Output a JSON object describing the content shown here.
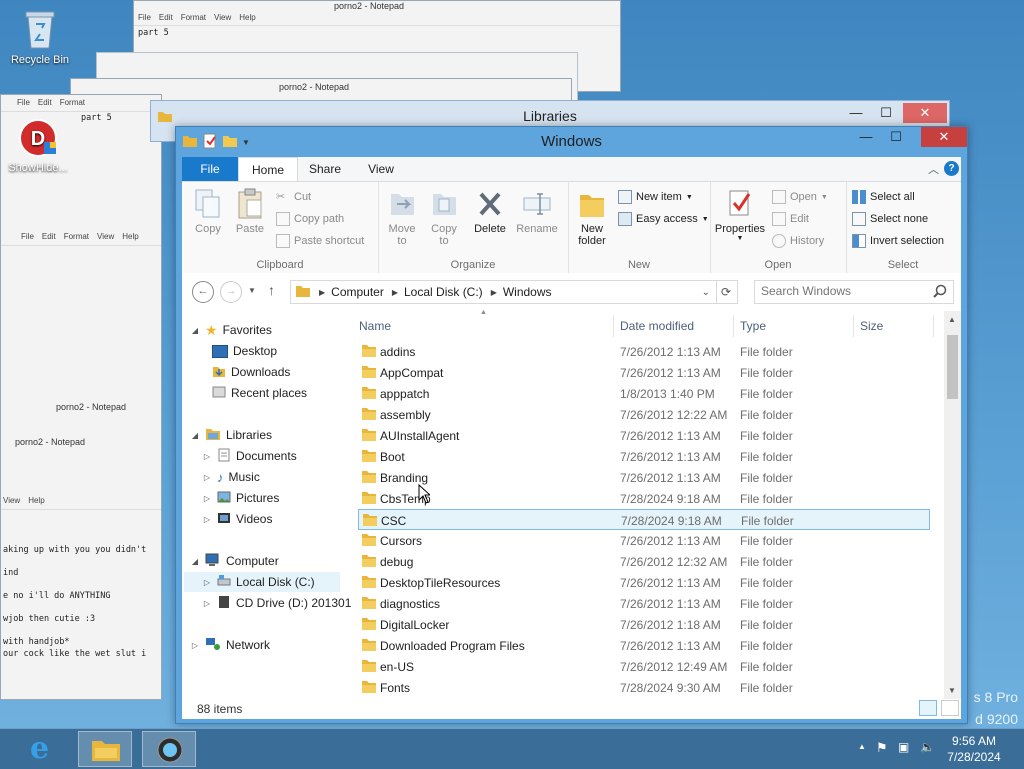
{
  "desktop": {
    "icons": [
      {
        "label": "Recycle Bin"
      },
      {
        "label": "ShowHide..."
      }
    ],
    "watermark": [
      "s 8 Pro",
      "d 9200"
    ]
  },
  "ghost_windows": {
    "notepad_title": "porno2 - Notepad",
    "notepad_menu": [
      "File",
      "Edit",
      "Format",
      "View",
      "Help"
    ],
    "notepad_text_top": "part 5",
    "notepad_lines": [
      "aking up with you you didn't",
      "ind",
      "e no i'll do ANYTHING",
      "wjob then cutie :3",
      " with handjob*",
      "our cock like the wet slut i"
    ],
    "libraries_title": "Libraries"
  },
  "window": {
    "title": "Windows",
    "tabs": {
      "file": "File",
      "home": "Home",
      "share": "Share",
      "view": "View"
    },
    "ribbon": {
      "clipboard": {
        "label": "Clipboard",
        "copy": "Copy",
        "paste": "Paste",
        "cut": "Cut",
        "copy_path": "Copy path",
        "paste_shortcut": "Paste shortcut"
      },
      "organize": {
        "label": "Organize",
        "move_to": "Move",
        "move_to2": "to",
        "copy_to": "Copy",
        "copy_to2": "to",
        "delete": "Delete",
        "rename": "Rename"
      },
      "new": {
        "label": "New",
        "new_folder": "New",
        "new_folder2": "folder",
        "new_item": "New item",
        "easy_access": "Easy access"
      },
      "open": {
        "label": "Open",
        "properties": "Properties",
        "open": "Open",
        "edit": "Edit",
        "history": "History"
      },
      "select": {
        "label": "Select",
        "select_all": "Select all",
        "select_none": "Select none",
        "invert": "Invert selection"
      }
    },
    "address": {
      "crumbs": [
        "Computer",
        "Local Disk (C:)",
        "Windows"
      ],
      "search_placeholder": "Search Windows"
    },
    "nav": {
      "favorites": "Favorites",
      "desktop": "Desktop",
      "downloads": "Downloads",
      "recent": "Recent places",
      "libraries": "Libraries",
      "documents": "Documents",
      "music": "Music",
      "pictures": "Pictures",
      "videos": "Videos",
      "computer": "Computer",
      "local_disk": "Local Disk (C:)",
      "cd_drive": "CD Drive (D:) 201301",
      "network": "Network"
    },
    "columns": {
      "name": "Name",
      "date": "Date modified",
      "type": "Type",
      "size": "Size"
    },
    "files": [
      {
        "name": "addins",
        "date": "7/26/2012 1:13 AM",
        "type": "File folder"
      },
      {
        "name": "AppCompat",
        "date": "7/26/2012 1:13 AM",
        "type": "File folder"
      },
      {
        "name": "apppatch",
        "date": "1/8/2013 1:40 PM",
        "type": "File folder"
      },
      {
        "name": "assembly",
        "date": "7/26/2012 12:22 AM",
        "type": "File folder"
      },
      {
        "name": "AUInstallAgent",
        "date": "7/26/2012 1:13 AM",
        "type": "File folder"
      },
      {
        "name": "Boot",
        "date": "7/26/2012 1:13 AM",
        "type": "File folder"
      },
      {
        "name": "Branding",
        "date": "7/26/2012 1:13 AM",
        "type": "File folder"
      },
      {
        "name": "CbsTemp",
        "date": "7/28/2024 9:18 AM",
        "type": "File folder"
      },
      {
        "name": "CSC",
        "date": "7/28/2024 9:18 AM",
        "type": "File folder"
      },
      {
        "name": "Cursors",
        "date": "7/26/2012 1:13 AM",
        "type": "File folder"
      },
      {
        "name": "debug",
        "date": "7/26/2012 12:32 AM",
        "type": "File folder"
      },
      {
        "name": "DesktopTileResources",
        "date": "7/26/2012 1:13 AM",
        "type": "File folder"
      },
      {
        "name": "diagnostics",
        "date": "7/26/2012 1:13 AM",
        "type": "File folder"
      },
      {
        "name": "DigitalLocker",
        "date": "7/26/2012 1:18 AM",
        "type": "File folder"
      },
      {
        "name": "Downloaded Program Files",
        "date": "7/26/2012 1:13 AM",
        "type": "File folder"
      },
      {
        "name": "en-US",
        "date": "7/26/2012 12:49 AM",
        "type": "File folder"
      },
      {
        "name": "Fonts",
        "date": "7/28/2024 9:30 AM",
        "type": "File folder"
      }
    ],
    "status": "88 items"
  },
  "taskbar": {
    "time": "9:56 AM",
    "date": "7/28/2024"
  },
  "colors": {
    "accent": "#1979ca",
    "folder": "#e8b63c",
    "selection": "#e5f3fb",
    "close": "#c74040"
  }
}
